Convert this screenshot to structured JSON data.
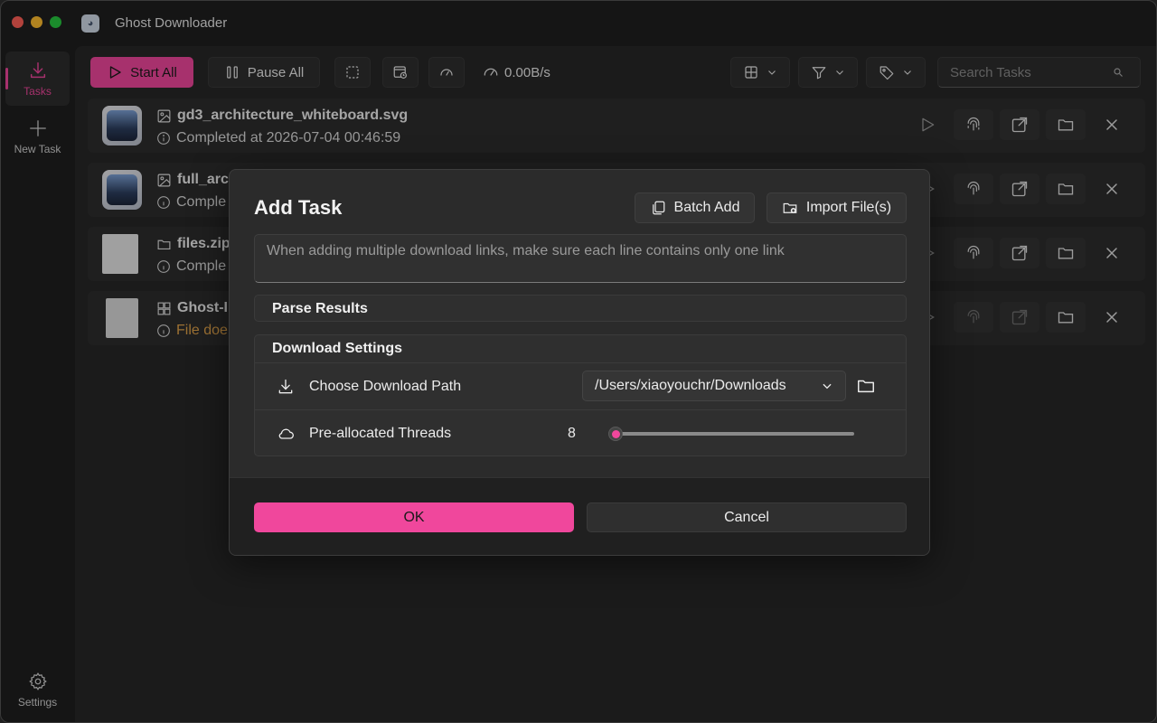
{
  "window": {
    "title": "Ghost Downloader"
  },
  "sidebar": {
    "items": [
      {
        "label": "Tasks",
        "icon": "download-icon",
        "active": true
      },
      {
        "label": "New Task",
        "icon": "plus-icon",
        "active": false
      }
    ],
    "settings_label": "Settings"
  },
  "toolbar": {
    "start_all": "Start All",
    "pause_all": "Pause All",
    "speed": "0.00B/s",
    "search_placeholder": "Search Tasks"
  },
  "tasks": [
    {
      "name": "gd3_architecture_whiteboard.svg",
      "status": "Completed at 2026-07-04 00:46:59",
      "type": "image"
    },
    {
      "name": "full_arc",
      "status": "Comple",
      "type": "image"
    },
    {
      "name": "files.zip",
      "status": "Comple",
      "type": "zip"
    },
    {
      "name": "Ghost-I",
      "status": "File doe",
      "type": "file",
      "warning": true
    }
  ],
  "dialog": {
    "title": "Add Task",
    "batch_add": "Batch Add",
    "import_files": "Import File(s)",
    "links_placeholder": "When adding multiple download links, make sure each line contains only one link",
    "parse_results": "Parse Results",
    "download_settings": "Download Settings",
    "download_path_label": "Choose Download Path",
    "download_path": "/Users/xiaoyouchr/Downloads",
    "threads_label": "Pre-allocated Threads",
    "threads_value": "8",
    "threads_fraction": 0.0,
    "ok": "OK",
    "cancel": "Cancel"
  },
  "colors": {
    "accent": "#f0479c",
    "warning": "#e0a24a"
  }
}
